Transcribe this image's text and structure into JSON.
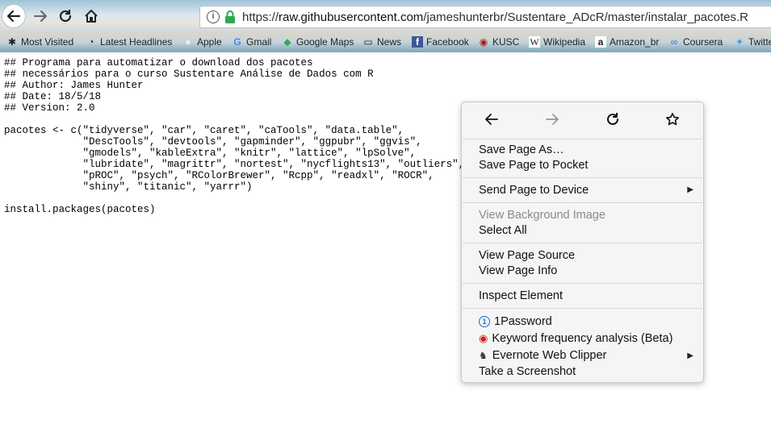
{
  "browser": {
    "url": "https://raw.githubusercontent.com/jameshunterbr/Sustentare_ADcR/master/instalar_pacotes.R",
    "url_prefix": "https://",
    "url_host": "raw.githubusercontent.com",
    "url_path": "/jameshunterbr/Sustentare_ADcR/master/instalar_pacotes.R"
  },
  "bookmarks": [
    {
      "label": "Most Visited",
      "icon": "gear-icon"
    },
    {
      "label": "Latest Headlines",
      "icon": "rss-icon"
    },
    {
      "label": "Apple",
      "icon": "apple-icon"
    },
    {
      "label": "Gmail",
      "icon": "google-icon"
    },
    {
      "label": "Google Maps",
      "icon": "maps-icon"
    },
    {
      "label": "News",
      "icon": "folder-icon"
    },
    {
      "label": "Facebook",
      "icon": "facebook-icon"
    },
    {
      "label": "KUSC",
      "icon": "radio-icon"
    },
    {
      "label": "Wikipedia",
      "icon": "wikipedia-icon"
    },
    {
      "label": "Amazon_br",
      "icon": "amazon-icon"
    },
    {
      "label": "Coursera",
      "icon": "coursera-icon"
    },
    {
      "label": "Twitter",
      "icon": "twitter-icon"
    }
  ],
  "document": {
    "lines": [
      "## Programa para automatizar o download dos pacotes",
      "## necessários para o curso Sustentare Análise de Dados com R",
      "## Author: James Hunter",
      "## Date: 18/5/18",
      "## Version: 2.0",
      "",
      "pacotes <- c(\"tidyverse\", \"car\", \"caret\", \"caTools\", \"data.table\",",
      "             \"DescTools\", \"devtools\", \"gapminder\", \"ggpubr\", \"ggvis\",",
      "             \"gmodels\", \"kableExtra\", \"knitr\", \"lattice\", \"lpSolve\",",
      "             \"lubridate\", \"magrittr\", \"nortest\", \"nycflights13\", \"outliers\",",
      "             \"pROC\", \"psych\", \"RColorBrewer\", \"Rcpp\", \"readxl\", \"ROCR\",",
      "             \"shiny\", \"titanic\", \"yarrr\")",
      "",
      "install.packages(pacotes)"
    ]
  },
  "context_menu": {
    "save_page_as": "Save Page As…",
    "save_to_pocket": "Save Page to Pocket",
    "send_to_device": "Send Page to Device",
    "view_background": "View Background Image",
    "select_all": "Select All",
    "view_source": "View Page Source",
    "view_info": "View Page Info",
    "inspect": "Inspect Element",
    "onepassword": "1Password",
    "keyword": "Keyword frequency analysis (Beta)",
    "evernote": "Evernote Web Clipper",
    "screenshot": "Take a Screenshot"
  },
  "colors": {
    "lock": "#2fa84f",
    "keyword_icon": "#d11c1c",
    "onepassword_icon": "#1a6fd1",
    "facebook": "#3b5998",
    "twitter": "#1da1f2"
  }
}
